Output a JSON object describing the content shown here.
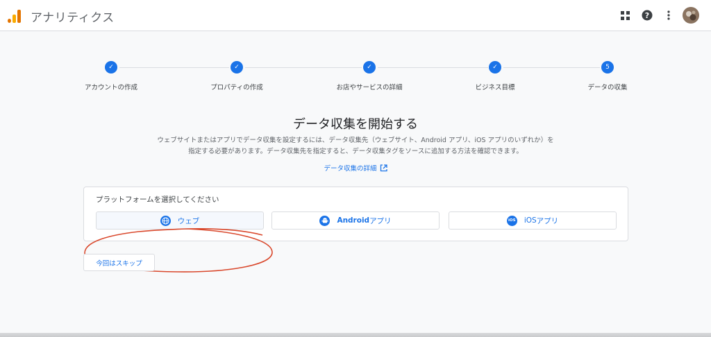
{
  "header": {
    "app_title": "アナリティクス",
    "icons": [
      "apps-icon",
      "help-icon",
      "more-vert-icon",
      "avatar"
    ]
  },
  "stepper": {
    "steps": [
      {
        "label": "アカウントの作成",
        "status": "done",
        "marker": "✓"
      },
      {
        "label": "プロパティの作成",
        "status": "done",
        "marker": "✓"
      },
      {
        "label": "お店やサービスの詳細",
        "status": "done",
        "marker": "✓"
      },
      {
        "label": "ビジネス目標",
        "status": "done",
        "marker": "✓"
      },
      {
        "label": "データの収集",
        "status": "current",
        "marker": "5"
      }
    ]
  },
  "main": {
    "heading": "データ収集を開始する",
    "description": "ウェブサイトまたはアプリでデータ収集を設定するには、データ収集先（ウェブサイト、Android アプリ、iOS アプリのいずれか）を指定する必要があります。データ収集先を指定すると、データ収集タグをソースに追加する方法を確認できます。",
    "learn_more": "データ収集の詳細"
  },
  "platform": {
    "prompt": "プラットフォームを選択してください",
    "web_label": "ウェブ",
    "android_brand": "Android",
    "android_suffix": " アプリ",
    "ios_brand": "iOS",
    "ios_suffix": " アプリ",
    "ios_icon_text": "iOS"
  },
  "skip_label": "今回はスキップ",
  "colors": {
    "primary": "#1a73e8",
    "annotation": "#d9472b",
    "logo_orange": "#f9ab00",
    "logo_dark_orange": "#e37400"
  }
}
